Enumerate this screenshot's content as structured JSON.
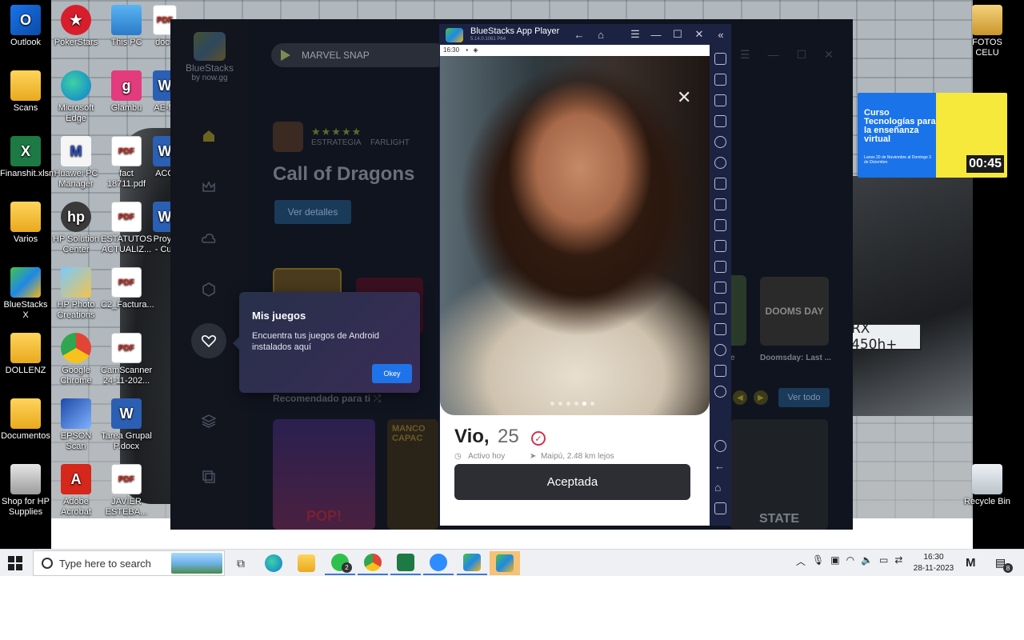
{
  "desktop": {
    "icons_left": [
      {
        "label": "Outlook",
        "icon": "outlook-icon"
      },
      {
        "label": "Scans",
        "icon": "folder-icon"
      },
      {
        "label": "Finanshit.xlsm",
        "icon": "excel-icon"
      },
      {
        "label": "Varios",
        "icon": "folder-icon"
      },
      {
        "label": "BlueStacks X",
        "icon": "bluestacks-icon"
      },
      {
        "label": "DOLLENZ",
        "icon": "folder-icon"
      },
      {
        "label": "Documentos",
        "icon": "folder-icon"
      },
      {
        "label": "Shop for HP Supplies",
        "icon": "printer-icon"
      }
    ],
    "icons_col2": [
      {
        "label": "PokerStars",
        "icon": "pokerstars-icon"
      },
      {
        "label": "Microsoft Edge",
        "icon": "edge-icon"
      },
      {
        "label": "Huawei PC Manager",
        "icon": "huawei-icon"
      },
      {
        "label": "HP Solution Center",
        "icon": "hp-icon"
      },
      {
        "label": "HP Photo Creations",
        "icon": "photo-icon"
      },
      {
        "label": "Google Chrome",
        "icon": "chrome-icon"
      },
      {
        "label": "EPSON Scan",
        "icon": "epson-icon"
      },
      {
        "label": "Adobe Acrobat",
        "icon": "adobe-icon"
      }
    ],
    "icons_col3": [
      {
        "label": "This PC",
        "icon": "pc-icon"
      },
      {
        "label": "Glambu",
        "icon": "glambu-icon"
      },
      {
        "label": "fact 18711.pdf",
        "icon": "pdf-icon"
      },
      {
        "label": "ESTATUTOS ACTUALIZ...",
        "icon": "pdf-icon"
      },
      {
        "label": "C2_Factura...",
        "icon": "pdf-icon"
      },
      {
        "label": "CamScanner 24-11-202...",
        "icon": "pdf-icon"
      },
      {
        "label": "Tarea Grupal P.docx",
        "icon": "word-icon"
      },
      {
        "label": "JAVIER ESTEBA...",
        "icon": "pdf-icon"
      }
    ],
    "icons_col4": [
      {
        "label": "docu",
        "icon": "pdf-icon"
      },
      {
        "label": "AE-fa",
        "icon": "word-icon"
      },
      {
        "label": "ACO",
        "icon": "word-icon"
      },
      {
        "label": "Proye - Cur",
        "icon": "word-icon"
      }
    ],
    "icons_right": [
      {
        "label": "FOTOS CELU",
        "icon": "folder-icon"
      },
      {
        "label": "Recycle Bin",
        "icon": "recycle-bin-icon"
      }
    ],
    "plate": "RX 450h+",
    "ad": {
      "title": "Curso Tecnologías para la enseñanza virtual",
      "sub": "Lunes 20 de Noviembre al Domingo 3 de Diciembre",
      "timer": "00:45"
    }
  },
  "launcher": {
    "logo": "BlueStacks",
    "logo_sub": "by now.gg",
    "search_value": "MARVEL SNAP",
    "stars": "★★★★★",
    "genre": "ESTRATEGIA",
    "publisher": "FARLIGHT",
    "game_title": "Call of Dragons",
    "details_button": "Ver detalles",
    "recommended": "Recomendado para ti",
    "see_all": "Ver todo",
    "game_card_label": "Doomsday: Last ...",
    "game_card_label2": "e",
    "dooms_art": "DOOMS DAY",
    "card_pop": "POP!",
    "card_manco": "MANCO CAPAC",
    "card_state": "STATE"
  },
  "tooltip": {
    "title": "Mis juegos",
    "body": "Encuentra tus juegos de Android instalados aquí",
    "ok": "Okey"
  },
  "player": {
    "title": "BlueStacks App Player",
    "version": "5.14.0.1061 P64",
    "status_time": "16:30",
    "profile_name": "Vio,",
    "profile_age": "25",
    "active": "Activo hoy",
    "location": "Maipú, 2.48 km lejos",
    "accept_button": "Aceptada",
    "photo_dots": 6,
    "photo_active_dot": 5
  },
  "taskbar": {
    "search_placeholder": "Type here to search",
    "whatsapp_badge": "2",
    "time": "16:30",
    "date": "28-11-2023",
    "notifications": "8",
    "vendor": "M"
  }
}
